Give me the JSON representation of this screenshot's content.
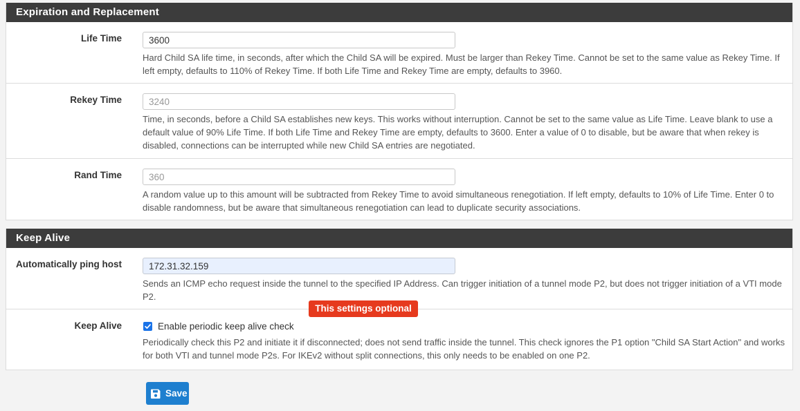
{
  "expiration": {
    "heading": "Expiration and Replacement",
    "life_time": {
      "label": "Life Time",
      "value": "3600",
      "help": "Hard Child SA life time, in seconds, after which the Child SA will be expired. Must be larger than Rekey Time. Cannot be set to the same value as Rekey Time. If left empty, defaults to 110% of Rekey Time. If both Life Time and Rekey Time are empty, defaults to 3960."
    },
    "rekey_time": {
      "label": "Rekey Time",
      "placeholder": "3240",
      "help": "Time, in seconds, before a Child SA establishes new keys. This works without interruption. Cannot be set to the same value as Life Time. Leave blank to use a default value of 90% Life Time. If both Life Time and Rekey Time are empty, defaults to 3600. Enter a value of 0 to disable, but be aware that when rekey is disabled, connections can be interrupted while new Child SA entries are negotiated."
    },
    "rand_time": {
      "label": "Rand Time",
      "placeholder": "360",
      "help": "A random value up to this amount will be subtracted from Rekey Time to avoid simultaneous renegotiation. If left empty, defaults to 10% of Life Time. Enter 0 to disable randomness, but be aware that simultaneous renegotiation can lead to duplicate security associations."
    }
  },
  "keepalive": {
    "heading": "Keep Alive",
    "ping_host": {
      "label": "Automatically ping host",
      "value": "172.31.32.159",
      "help": "Sends an ICMP echo request inside the tunnel to the specified IP Address. Can trigger initiation of a tunnel mode P2, but does not trigger initiation of a VTI mode P2."
    },
    "keep_alive": {
      "label": "Keep Alive",
      "checkbox_label": "Enable periodic keep alive check",
      "checked": true,
      "help": "Periodically check this P2 and initiate it if disconnected; does not send traffic inside the tunnel. This check ignores the P1 option \"Child SA Start Action\" and works for both VTI and tunnel mode P2s. For IKEv2 without split connections, this only needs to be enabled on one P2."
    }
  },
  "tooltip": "This settings optional",
  "save_label": "Save",
  "colors": {
    "heading_bg": "#3c3c3c",
    "save_button": "#1e7fcf",
    "tooltip_bg": "#e63a1e",
    "checkbox": "#1a73e8"
  }
}
